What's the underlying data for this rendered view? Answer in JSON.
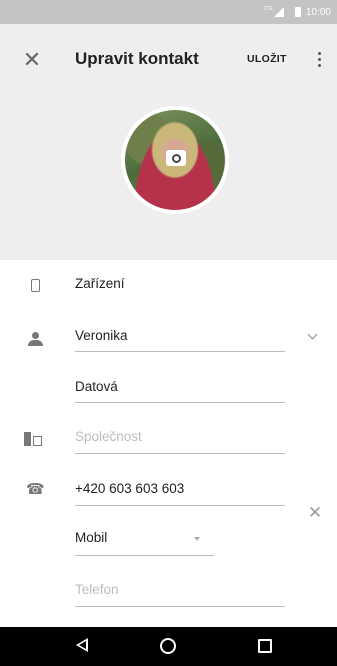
{
  "status_bar": {
    "network": "LTE",
    "time": "10:00"
  },
  "header": {
    "close_icon": "close-icon",
    "title": "Upravit kontakt",
    "save_label": "ULOŽIT",
    "more_icon": "more-vert-icon"
  },
  "avatar": {
    "camera_icon": "camera-icon"
  },
  "fields": {
    "account": "Zařízení",
    "first_name": "Veronika",
    "last_name": "Datová",
    "company_placeholder": "Společnost",
    "phone": "+420 603 603 603",
    "phone_type": "Mobil",
    "phone_placeholder": "Telefon"
  },
  "nav_bar": {
    "back_icon": "back-icon",
    "home_icon": "home-icon",
    "recents_icon": "recents-icon"
  },
  "colors": {
    "header_bg": "#eeeeee",
    "status_bar_bg": "#c4c4c4",
    "nav_bar_bg": "#000000",
    "placeholder": "#bdbdbd"
  }
}
